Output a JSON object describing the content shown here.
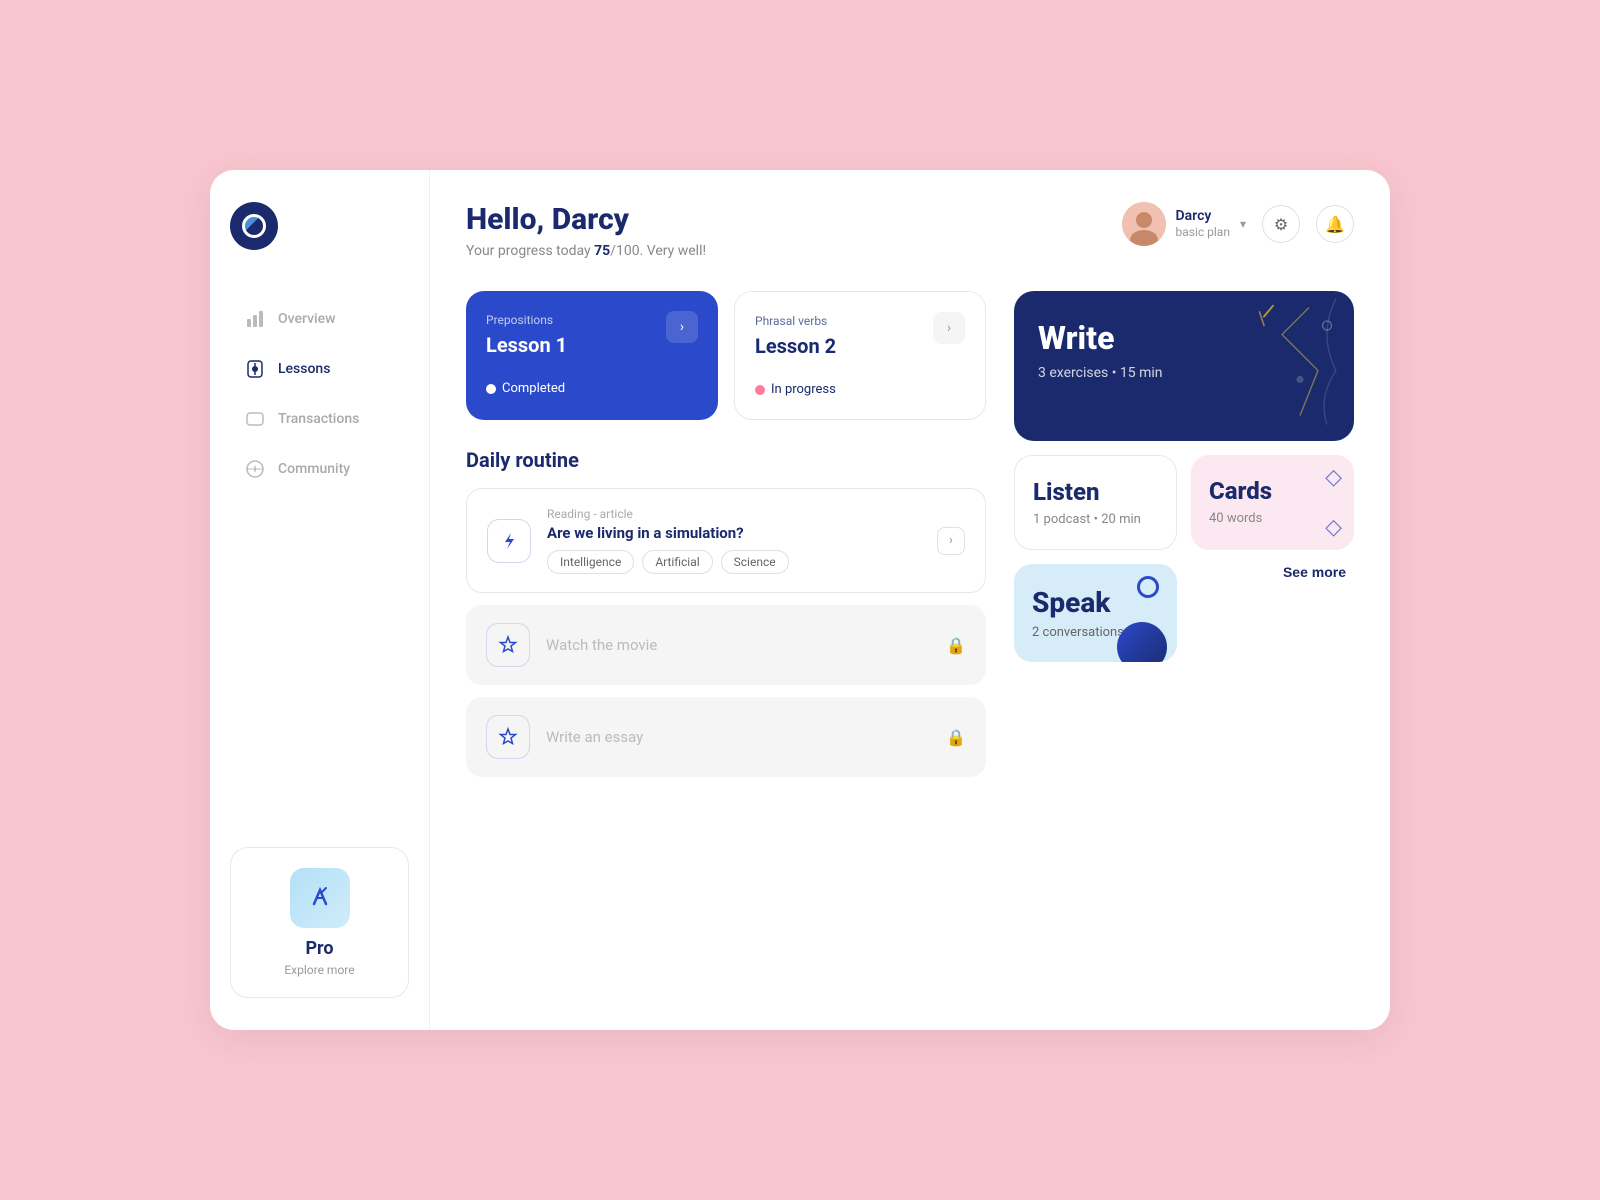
{
  "app": {
    "logo_alt": "App Logo"
  },
  "sidebar": {
    "nav_items": [
      {
        "id": "overview",
        "label": "Overview",
        "icon": "bar-chart-icon",
        "active": false
      },
      {
        "id": "lessons",
        "label": "Lessons",
        "icon": "lessons-icon",
        "active": true
      },
      {
        "id": "transactions",
        "label": "Transactions",
        "icon": "transactions-icon",
        "active": false
      },
      {
        "id": "community",
        "label": "Community",
        "icon": "community-icon",
        "active": false
      }
    ],
    "pro_card": {
      "label": "Pro",
      "sub_label": "Explore more"
    }
  },
  "header": {
    "greeting": "Hello, Darcy",
    "progress_text": "Your progress today ",
    "progress_value": "75",
    "progress_max": "100",
    "progress_suffix": ". Very well!",
    "user": {
      "name": "Darcy",
      "plan": "basic plan"
    },
    "settings_icon": "settings-icon",
    "notifications_icon": "bell-icon"
  },
  "lessons_row": {
    "lesson1": {
      "type": "Prepositions",
      "title": "Lesson 1",
      "status": "Completed",
      "arrow": "›"
    },
    "lesson2": {
      "type": "Phrasal verbs",
      "title": "Lesson 2",
      "status": "In progress",
      "arrow": "›"
    }
  },
  "daily_routine": {
    "section_title": "Daily routine",
    "items": [
      {
        "type": "Reading - article",
        "title": "Are we living in a simulation?",
        "tags": [
          "Intelligence",
          "Artificial",
          "Science"
        ],
        "locked": false,
        "icon": "bolt-icon"
      },
      {
        "type": "",
        "title": "Watch the movie",
        "tags": [],
        "locked": true,
        "icon": "star-icon"
      },
      {
        "type": "",
        "title": "Write an essay",
        "tags": [],
        "locked": true,
        "icon": "star-icon"
      }
    ]
  },
  "right_panel": {
    "write": {
      "title": "Write",
      "detail": "3 exercises  •  15 min"
    },
    "listen": {
      "title": "Listen",
      "detail": "1 podcast  •  20 min"
    },
    "cards": {
      "title": "Cards",
      "detail": "40 words"
    },
    "speak": {
      "title": "Speak",
      "detail": "2 conversations"
    },
    "see_more": "See more"
  }
}
